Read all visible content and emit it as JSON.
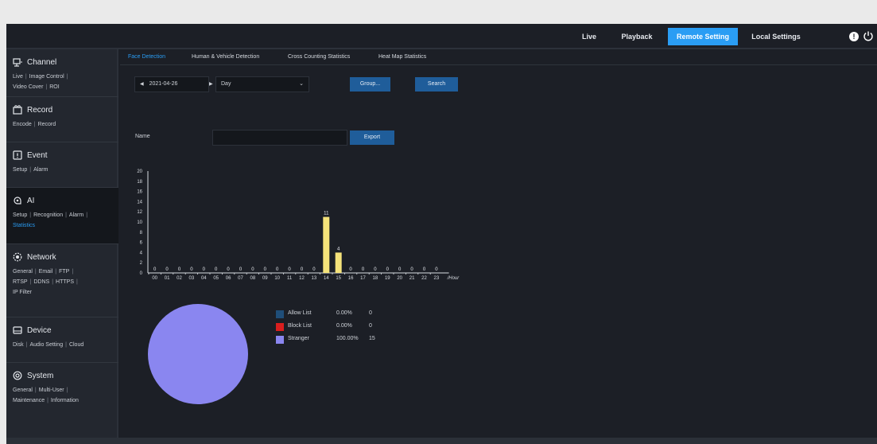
{
  "topnav": {
    "items": [
      {
        "label": "Live",
        "active": false
      },
      {
        "label": "Playback",
        "active": false
      },
      {
        "label": "Remote Setting",
        "active": true
      },
      {
        "label": "Local Settings",
        "active": false
      }
    ],
    "info_icon": "info-icon",
    "power_icon": "power-icon",
    "accent_color": "#2a9df4"
  },
  "sidebar": {
    "sections": [
      {
        "title": "Channel",
        "icon": "channel-icon",
        "links": [
          "Live",
          "Image Control",
          "Video Cover",
          "ROI"
        ]
      },
      {
        "title": "Record",
        "icon": "record-icon",
        "links": [
          "Encode",
          "Record"
        ]
      },
      {
        "title": "Event",
        "icon": "event-icon",
        "links": [
          "Setup",
          "Alarm"
        ]
      },
      {
        "title": "AI",
        "icon": "ai-icon",
        "links": [
          "Setup",
          "Recognition",
          "Alarm",
          "Statistics"
        ],
        "active": true,
        "active_link": "Statistics"
      },
      {
        "title": "Network",
        "icon": "network-icon",
        "links": [
          "General",
          "Email",
          "FTP",
          "RTSP",
          "DDNS",
          "HTTPS",
          "IP Filter"
        ]
      },
      {
        "title": "Device",
        "icon": "device-icon",
        "links": [
          "Disk",
          "Audio Setting",
          "Cloud"
        ]
      },
      {
        "title": "System",
        "icon": "system-icon",
        "links": [
          "General",
          "Multi-User",
          "Maintenance",
          "Information"
        ]
      }
    ]
  },
  "tabs": [
    {
      "label": "Face Detection",
      "active": true
    },
    {
      "label": "Human & Vehicle Detection",
      "active": false
    },
    {
      "label": "Cross Counting Statistics",
      "active": false
    },
    {
      "label": "Heat Map Statistics",
      "active": false
    }
  ],
  "controls": {
    "date_value": "2021-04-26",
    "period_value": "Day",
    "group_label": "Group...",
    "search_label": "Search",
    "name_label": "Name",
    "name_value": "",
    "export_label": "Export"
  },
  "chart_data": {
    "type": "bar",
    "categories": [
      "00",
      "01",
      "02",
      "03",
      "04",
      "05",
      "06",
      "07",
      "08",
      "09",
      "10",
      "11",
      "12",
      "13",
      "14",
      "15",
      "16",
      "17",
      "18",
      "19",
      "20",
      "21",
      "22",
      "23"
    ],
    "values": [
      0,
      0,
      0,
      0,
      0,
      0,
      0,
      0,
      0,
      0,
      0,
      0,
      0,
      0,
      11,
      4,
      0,
      0,
      0,
      0,
      0,
      0,
      0,
      0
    ],
    "xlabel": "Hour",
    "ylim": [
      0,
      20
    ],
    "yticks": [
      0,
      2,
      4,
      6,
      8,
      10,
      12,
      14,
      16,
      18,
      20
    ],
    "bar_color": "#f4e27a"
  },
  "pie": {
    "type": "pie",
    "legend": [
      {
        "name": "Allow List",
        "percent": "0.00%",
        "count": "0",
        "color": "#1f4e79"
      },
      {
        "name": "Block List",
        "percent": "0.00%",
        "count": "0",
        "color": "#d91e1e"
      },
      {
        "name": "Stranger",
        "percent": "100.00%",
        "count": "15",
        "color": "#8a86f0"
      }
    ],
    "values": [
      0,
      0,
      15
    ]
  }
}
